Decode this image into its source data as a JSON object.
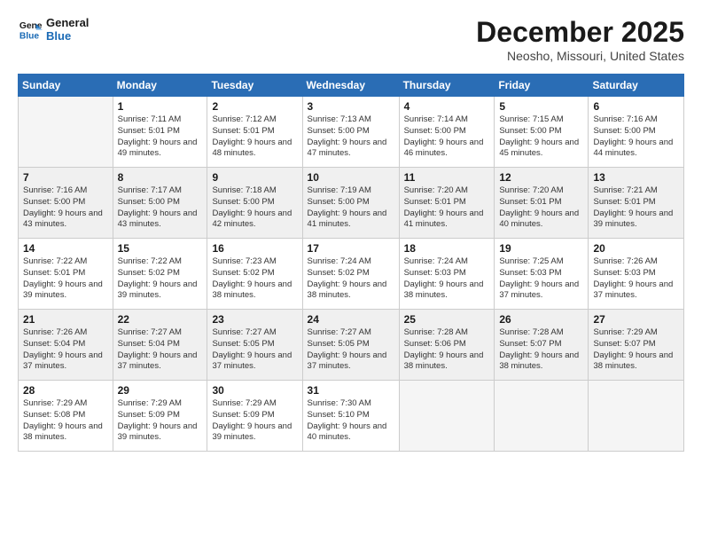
{
  "header": {
    "logo_line1": "General",
    "logo_line2": "Blue",
    "month": "December 2025",
    "location": "Neosho, Missouri, United States"
  },
  "weekdays": [
    "Sunday",
    "Monday",
    "Tuesday",
    "Wednesday",
    "Thursday",
    "Friday",
    "Saturday"
  ],
  "weeks": [
    [
      {
        "day": "",
        "empty": true
      },
      {
        "day": "1",
        "sunrise": "7:11 AM",
        "sunset": "5:01 PM",
        "daylight": "9 hours and 49 minutes."
      },
      {
        "day": "2",
        "sunrise": "7:12 AM",
        "sunset": "5:01 PM",
        "daylight": "9 hours and 48 minutes."
      },
      {
        "day": "3",
        "sunrise": "7:13 AM",
        "sunset": "5:00 PM",
        "daylight": "9 hours and 47 minutes."
      },
      {
        "day": "4",
        "sunrise": "7:14 AM",
        "sunset": "5:00 PM",
        "daylight": "9 hours and 46 minutes."
      },
      {
        "day": "5",
        "sunrise": "7:15 AM",
        "sunset": "5:00 PM",
        "daylight": "9 hours and 45 minutes."
      },
      {
        "day": "6",
        "sunrise": "7:16 AM",
        "sunset": "5:00 PM",
        "daylight": "9 hours and 44 minutes."
      }
    ],
    [
      {
        "day": "7",
        "sunrise": "7:16 AM",
        "sunset": "5:00 PM",
        "daylight": "9 hours and 43 minutes."
      },
      {
        "day": "8",
        "sunrise": "7:17 AM",
        "sunset": "5:00 PM",
        "daylight": "9 hours and 43 minutes."
      },
      {
        "day": "9",
        "sunrise": "7:18 AM",
        "sunset": "5:00 PM",
        "daylight": "9 hours and 42 minutes."
      },
      {
        "day": "10",
        "sunrise": "7:19 AM",
        "sunset": "5:00 PM",
        "daylight": "9 hours and 41 minutes."
      },
      {
        "day": "11",
        "sunrise": "7:20 AM",
        "sunset": "5:01 PM",
        "daylight": "9 hours and 41 minutes."
      },
      {
        "day": "12",
        "sunrise": "7:20 AM",
        "sunset": "5:01 PM",
        "daylight": "9 hours and 40 minutes."
      },
      {
        "day": "13",
        "sunrise": "7:21 AM",
        "sunset": "5:01 PM",
        "daylight": "9 hours and 39 minutes."
      }
    ],
    [
      {
        "day": "14",
        "sunrise": "7:22 AM",
        "sunset": "5:01 PM",
        "daylight": "9 hours and 39 minutes."
      },
      {
        "day": "15",
        "sunrise": "7:22 AM",
        "sunset": "5:02 PM",
        "daylight": "9 hours and 39 minutes."
      },
      {
        "day": "16",
        "sunrise": "7:23 AM",
        "sunset": "5:02 PM",
        "daylight": "9 hours and 38 minutes."
      },
      {
        "day": "17",
        "sunrise": "7:24 AM",
        "sunset": "5:02 PM",
        "daylight": "9 hours and 38 minutes."
      },
      {
        "day": "18",
        "sunrise": "7:24 AM",
        "sunset": "5:03 PM",
        "daylight": "9 hours and 38 minutes."
      },
      {
        "day": "19",
        "sunrise": "7:25 AM",
        "sunset": "5:03 PM",
        "daylight": "9 hours and 37 minutes."
      },
      {
        "day": "20",
        "sunrise": "7:26 AM",
        "sunset": "5:03 PM",
        "daylight": "9 hours and 37 minutes."
      }
    ],
    [
      {
        "day": "21",
        "sunrise": "7:26 AM",
        "sunset": "5:04 PM",
        "daylight": "9 hours and 37 minutes."
      },
      {
        "day": "22",
        "sunrise": "7:27 AM",
        "sunset": "5:04 PM",
        "daylight": "9 hours and 37 minutes."
      },
      {
        "day": "23",
        "sunrise": "7:27 AM",
        "sunset": "5:05 PM",
        "daylight": "9 hours and 37 minutes."
      },
      {
        "day": "24",
        "sunrise": "7:27 AM",
        "sunset": "5:05 PM",
        "daylight": "9 hours and 37 minutes."
      },
      {
        "day": "25",
        "sunrise": "7:28 AM",
        "sunset": "5:06 PM",
        "daylight": "9 hours and 38 minutes."
      },
      {
        "day": "26",
        "sunrise": "7:28 AM",
        "sunset": "5:07 PM",
        "daylight": "9 hours and 38 minutes."
      },
      {
        "day": "27",
        "sunrise": "7:29 AM",
        "sunset": "5:07 PM",
        "daylight": "9 hours and 38 minutes."
      }
    ],
    [
      {
        "day": "28",
        "sunrise": "7:29 AM",
        "sunset": "5:08 PM",
        "daylight": "9 hours and 38 minutes."
      },
      {
        "day": "29",
        "sunrise": "7:29 AM",
        "sunset": "5:09 PM",
        "daylight": "9 hours and 39 minutes."
      },
      {
        "day": "30",
        "sunrise": "7:29 AM",
        "sunset": "5:09 PM",
        "daylight": "9 hours and 39 minutes."
      },
      {
        "day": "31",
        "sunrise": "7:30 AM",
        "sunset": "5:10 PM",
        "daylight": "9 hours and 40 minutes."
      },
      {
        "day": "",
        "empty": true
      },
      {
        "day": "",
        "empty": true
      },
      {
        "day": "",
        "empty": true
      }
    ]
  ],
  "labels": {
    "sunrise": "Sunrise:",
    "sunset": "Sunset:",
    "daylight": "Daylight:"
  }
}
